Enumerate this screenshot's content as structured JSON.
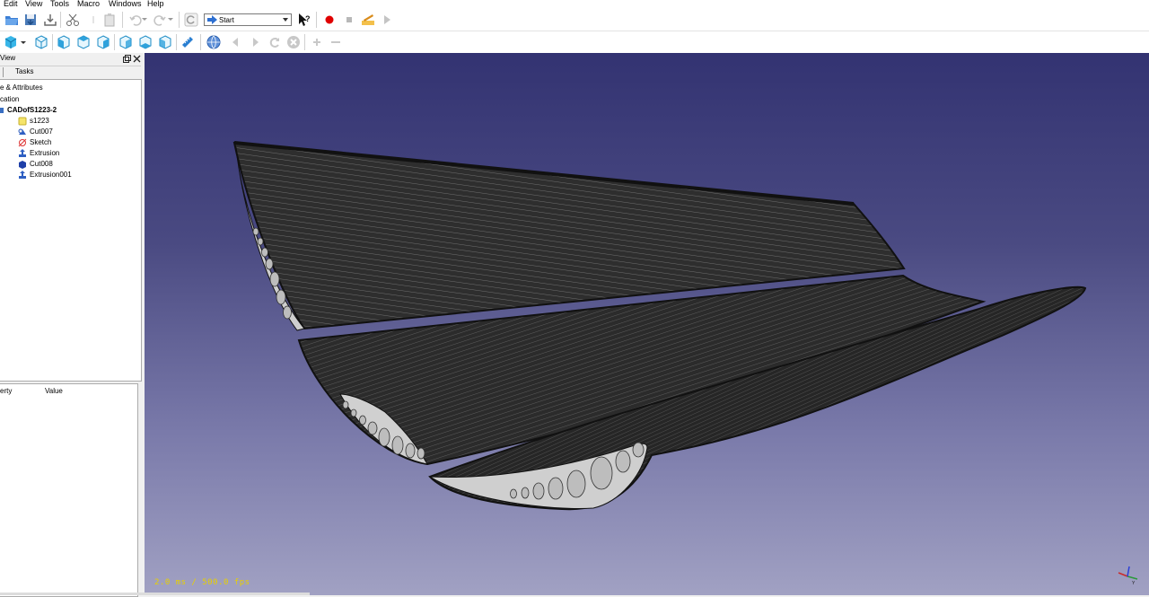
{
  "menu": {
    "items": [
      "Edit",
      "View",
      "Tools",
      "Macro",
      "Windows",
      "Help"
    ]
  },
  "toolbar": {
    "workbench": "Start"
  },
  "combo_view": {
    "title": "View",
    "tabs": [
      "",
      "Tasks"
    ],
    "section_label": "e & Attributes",
    "root_label": "cation",
    "document": "CADofS1223-2",
    "items": [
      {
        "label": "s1223",
        "icon": "sketch-yellow-icon"
      },
      {
        "label": "Cut007",
        "icon": "cut-icon"
      },
      {
        "label": "Sketch",
        "icon": "sketch-icon"
      },
      {
        "label": "Extrusion",
        "icon": "extrusion-icon"
      },
      {
        "label": "Cut008",
        "icon": "cut-solid-icon"
      },
      {
        "label": "Extrusion001",
        "icon": "extrusion-icon"
      }
    ]
  },
  "property_view": {
    "columns": [
      "erty",
      "Value"
    ]
  },
  "viewport": {
    "fps_text": "2.0 ms / 500.0 fps",
    "background_top": "#333372",
    "background_bottom": "#a1a1c3"
  },
  "colors": {
    "record": "#e00000",
    "wing_dark": "#2b2b2b",
    "wing_face": "#cfcfcf"
  }
}
